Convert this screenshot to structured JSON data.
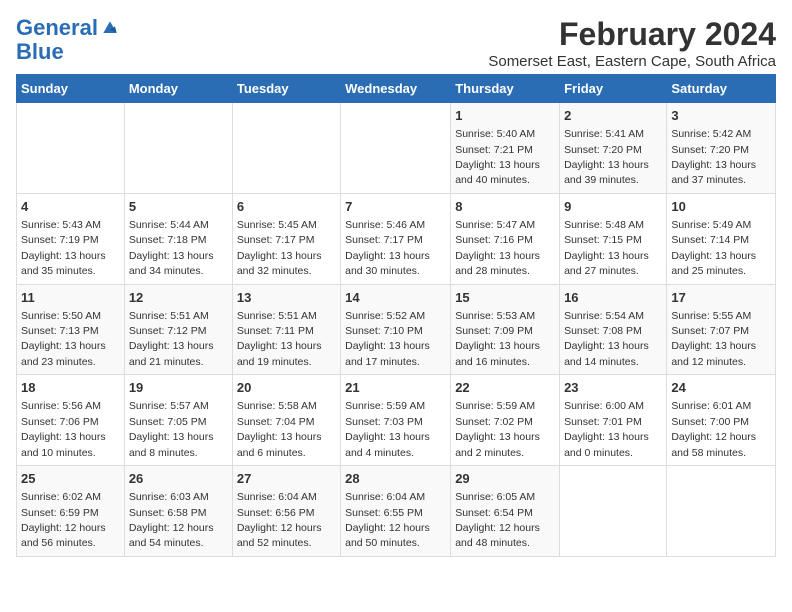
{
  "logo": {
    "line1": "General",
    "line2": "Blue"
  },
  "title": "February 2024",
  "subtitle": "Somerset East, Eastern Cape, South Africa",
  "days_of_week": [
    "Sunday",
    "Monday",
    "Tuesday",
    "Wednesday",
    "Thursday",
    "Friday",
    "Saturday"
  ],
  "weeks": [
    [
      {
        "num": "",
        "sunrise": "",
        "sunset": "",
        "daylight": ""
      },
      {
        "num": "",
        "sunrise": "",
        "sunset": "",
        "daylight": ""
      },
      {
        "num": "",
        "sunrise": "",
        "sunset": "",
        "daylight": ""
      },
      {
        "num": "",
        "sunrise": "",
        "sunset": "",
        "daylight": ""
      },
      {
        "num": "1",
        "sunrise": "Sunrise: 5:40 AM",
        "sunset": "Sunset: 7:21 PM",
        "daylight": "Daylight: 13 hours and 40 minutes."
      },
      {
        "num": "2",
        "sunrise": "Sunrise: 5:41 AM",
        "sunset": "Sunset: 7:20 PM",
        "daylight": "Daylight: 13 hours and 39 minutes."
      },
      {
        "num": "3",
        "sunrise": "Sunrise: 5:42 AM",
        "sunset": "Sunset: 7:20 PM",
        "daylight": "Daylight: 13 hours and 37 minutes."
      }
    ],
    [
      {
        "num": "4",
        "sunrise": "Sunrise: 5:43 AM",
        "sunset": "Sunset: 7:19 PM",
        "daylight": "Daylight: 13 hours and 35 minutes."
      },
      {
        "num": "5",
        "sunrise": "Sunrise: 5:44 AM",
        "sunset": "Sunset: 7:18 PM",
        "daylight": "Daylight: 13 hours and 34 minutes."
      },
      {
        "num": "6",
        "sunrise": "Sunrise: 5:45 AM",
        "sunset": "Sunset: 7:17 PM",
        "daylight": "Daylight: 13 hours and 32 minutes."
      },
      {
        "num": "7",
        "sunrise": "Sunrise: 5:46 AM",
        "sunset": "Sunset: 7:17 PM",
        "daylight": "Daylight: 13 hours and 30 minutes."
      },
      {
        "num": "8",
        "sunrise": "Sunrise: 5:47 AM",
        "sunset": "Sunset: 7:16 PM",
        "daylight": "Daylight: 13 hours and 28 minutes."
      },
      {
        "num": "9",
        "sunrise": "Sunrise: 5:48 AM",
        "sunset": "Sunset: 7:15 PM",
        "daylight": "Daylight: 13 hours and 27 minutes."
      },
      {
        "num": "10",
        "sunrise": "Sunrise: 5:49 AM",
        "sunset": "Sunset: 7:14 PM",
        "daylight": "Daylight: 13 hours and 25 minutes."
      }
    ],
    [
      {
        "num": "11",
        "sunrise": "Sunrise: 5:50 AM",
        "sunset": "Sunset: 7:13 PM",
        "daylight": "Daylight: 13 hours and 23 minutes."
      },
      {
        "num": "12",
        "sunrise": "Sunrise: 5:51 AM",
        "sunset": "Sunset: 7:12 PM",
        "daylight": "Daylight: 13 hours and 21 minutes."
      },
      {
        "num": "13",
        "sunrise": "Sunrise: 5:51 AM",
        "sunset": "Sunset: 7:11 PM",
        "daylight": "Daylight: 13 hours and 19 minutes."
      },
      {
        "num": "14",
        "sunrise": "Sunrise: 5:52 AM",
        "sunset": "Sunset: 7:10 PM",
        "daylight": "Daylight: 13 hours and 17 minutes."
      },
      {
        "num": "15",
        "sunrise": "Sunrise: 5:53 AM",
        "sunset": "Sunset: 7:09 PM",
        "daylight": "Daylight: 13 hours and 16 minutes."
      },
      {
        "num": "16",
        "sunrise": "Sunrise: 5:54 AM",
        "sunset": "Sunset: 7:08 PM",
        "daylight": "Daylight: 13 hours and 14 minutes."
      },
      {
        "num": "17",
        "sunrise": "Sunrise: 5:55 AM",
        "sunset": "Sunset: 7:07 PM",
        "daylight": "Daylight: 13 hours and 12 minutes."
      }
    ],
    [
      {
        "num": "18",
        "sunrise": "Sunrise: 5:56 AM",
        "sunset": "Sunset: 7:06 PM",
        "daylight": "Daylight: 13 hours and 10 minutes."
      },
      {
        "num": "19",
        "sunrise": "Sunrise: 5:57 AM",
        "sunset": "Sunset: 7:05 PM",
        "daylight": "Daylight: 13 hours and 8 minutes."
      },
      {
        "num": "20",
        "sunrise": "Sunrise: 5:58 AM",
        "sunset": "Sunset: 7:04 PM",
        "daylight": "Daylight: 13 hours and 6 minutes."
      },
      {
        "num": "21",
        "sunrise": "Sunrise: 5:59 AM",
        "sunset": "Sunset: 7:03 PM",
        "daylight": "Daylight: 13 hours and 4 minutes."
      },
      {
        "num": "22",
        "sunrise": "Sunrise: 5:59 AM",
        "sunset": "Sunset: 7:02 PM",
        "daylight": "Daylight: 13 hours and 2 minutes."
      },
      {
        "num": "23",
        "sunrise": "Sunrise: 6:00 AM",
        "sunset": "Sunset: 7:01 PM",
        "daylight": "Daylight: 13 hours and 0 minutes."
      },
      {
        "num": "24",
        "sunrise": "Sunrise: 6:01 AM",
        "sunset": "Sunset: 7:00 PM",
        "daylight": "Daylight: 12 hours and 58 minutes."
      }
    ],
    [
      {
        "num": "25",
        "sunrise": "Sunrise: 6:02 AM",
        "sunset": "Sunset: 6:59 PM",
        "daylight": "Daylight: 12 hours and 56 minutes."
      },
      {
        "num": "26",
        "sunrise": "Sunrise: 6:03 AM",
        "sunset": "Sunset: 6:58 PM",
        "daylight": "Daylight: 12 hours and 54 minutes."
      },
      {
        "num": "27",
        "sunrise": "Sunrise: 6:04 AM",
        "sunset": "Sunset: 6:56 PM",
        "daylight": "Daylight: 12 hours and 52 minutes."
      },
      {
        "num": "28",
        "sunrise": "Sunrise: 6:04 AM",
        "sunset": "Sunset: 6:55 PM",
        "daylight": "Daylight: 12 hours and 50 minutes."
      },
      {
        "num": "29",
        "sunrise": "Sunrise: 6:05 AM",
        "sunset": "Sunset: 6:54 PM",
        "daylight": "Daylight: 12 hours and 48 minutes."
      },
      {
        "num": "",
        "sunrise": "",
        "sunset": "",
        "daylight": ""
      },
      {
        "num": "",
        "sunrise": "",
        "sunset": "",
        "daylight": ""
      }
    ]
  ]
}
